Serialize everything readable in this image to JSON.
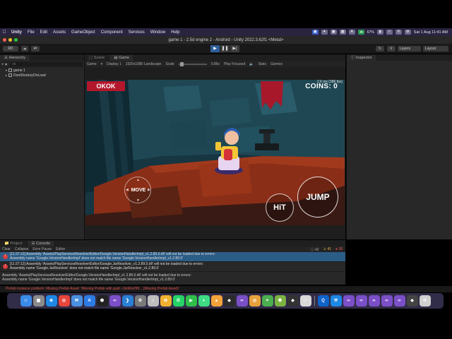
{
  "menubar": {
    "items": [
      "Unity",
      "File",
      "Edit",
      "Assets",
      "GameObject",
      "Component",
      "Services",
      "Window",
      "Help"
    ],
    "battery": "67%",
    "datetime": "Sat 1 Aug  11:41 AM"
  },
  "window": {
    "title": "game 1 - 2.5d engine 2 - Android - Unity 2022.3.62f1 <Metal>"
  },
  "toolbar": {
    "account": "RD",
    "layers_label": "Layers",
    "layout_label": "Layout"
  },
  "hierarchy": {
    "tab_label": "Hierarchy",
    "search_placeholder": "All",
    "items": [
      {
        "label": "game 1"
      },
      {
        "label": "DontDestroyOnLoad"
      }
    ]
  },
  "game_view": {
    "tabs": [
      "Scene",
      "Game"
    ],
    "toolbar": {
      "mode": "Game",
      "display": "Display 1",
      "resolution": "1920x1080 Landscape",
      "scale_label": "Scale",
      "scale_value": "0.86x",
      "play_focused": "Play Focused",
      "stats": "Stats",
      "gizmos": "Gizmos"
    },
    "hud": {
      "player_name": "OKOK",
      "coins_label": "COINS:",
      "coins_value": "0",
      "fps": "2.6 ms (386 fps)",
      "move_label": "MOVE",
      "hit_label": "HiT",
      "jump_label": "JUMP"
    }
  },
  "inspector": {
    "tab_label": "Inspector"
  },
  "console": {
    "tabs": [
      "Project",
      "Console"
    ],
    "toolbar": [
      "Clear",
      "Collapse",
      "Error Pause",
      "Editor"
    ],
    "counts": {
      "info": "42",
      "warnings": "41",
      "errors": "38"
    },
    "messages": [
      {
        "line1": "[11:37:12] Assembly 'Assets/PlayServicesResolver/Editor/Google.VersionHandlerImpl_v1.2.89.0.dll' will not be loaded due to errors:",
        "line2": "Assembly name 'Google.VersionHandlerImpl' does not match file name 'Google.VersionHandlerImpl_v1.2.89.0'"
      },
      {
        "line1": "[11:37:12] Assembly 'Assets/PlayServicesResolver/Editor/Google.JarResolver_v1.2.89.0.dll' will not be loaded due to errors:",
        "line2": "Assembly name 'Google.JarResolver' does not match file name 'Google.JarResolver_v1.2.89.0'"
      }
    ],
    "detail": [
      "Assembly 'Assets/PlayServicesResolver/Editor/Google.VersionHandlerImpl_v1.2.89.0.dll' will not be loaded due to errors:",
      "Assembly name 'Google.VersionHandlerImpl' does not match file name 'Google.VersionHandlerImpl_v1.2.89.0'"
    ]
  },
  "status_bar": {
    "text": "Prefab instance problem: Missing Prefab Asset: 'Missing Prefab with guid: c3e90e2f6f... (Missing Prefab Asset)'"
  },
  "dock": {
    "icons": [
      "finder-icon",
      "launchpad-icon",
      "safari-icon",
      "chrome-icon",
      "mail-icon",
      "app-store-icon",
      "unity-hub-icon",
      "visual-studio-icon",
      "vscode-icon",
      "settings-icon",
      "mp3-icon",
      "photos-icon",
      "whatsapp-icon",
      "facetime-icon",
      "android-studio-icon",
      "keynote-icon",
      "unity-icon",
      "visual-studio-icon-2",
      "chrome-canary-icon",
      "maps-icon",
      "android-icon",
      "unity-icon-2",
      "finder-window-icon",
      "quicktime-icon",
      "xcode-icon",
      "visual-studio-icon-3",
      "visual-studio-icon-4",
      "visual-studio-icon-5",
      "visual-studio-icon-6",
      "visual-studio-icon-7",
      "unity-icon-3",
      "trash-icon"
    ],
    "colors": [
      "#3a8ce8",
      "#8a8a8a",
      "#1f88e5",
      "#e8453c",
      "#4a8fe0",
      "#2d7be3",
      "#222222",
      "#7b4fc7",
      "#2a7fd4",
      "#7a7a7a",
      "#bdbdbd",
      "#f0b030",
      "#25d366",
      "#2fbf4a",
      "#3ddc84",
      "#f2a33a",
      "#2b2b2b",
      "#7b4fc7",
      "#e8a23c",
      "#4caf50",
      "#7cb342",
      "#333333",
      "#d8d8d8",
      "#0f63c9",
      "#1e88e5",
      "#7b4fc7",
      "#7b4fc7",
      "#7b4fc7",
      "#7b4fc7",
      "#7b4fc7",
      "#444444",
      "#cfcfcf"
    ]
  }
}
